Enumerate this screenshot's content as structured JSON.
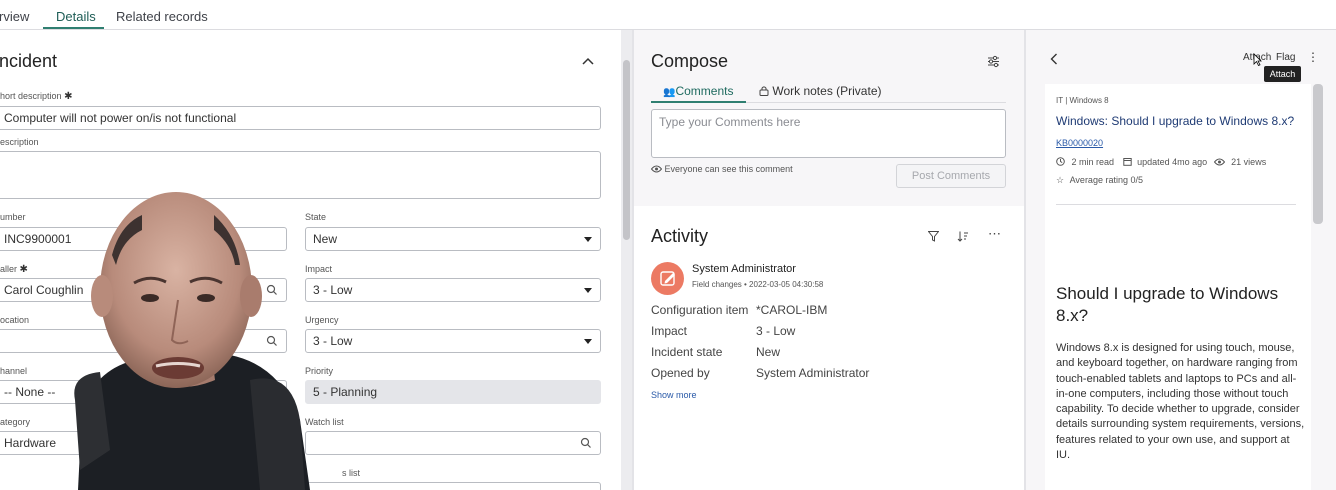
{
  "tabs": [
    {
      "label": "rview"
    },
    {
      "label": "Details"
    },
    {
      "label": "Related records"
    }
  ],
  "form": {
    "title": "ncident",
    "short_description_label": "hort description",
    "short_description_value": "Computer will not power on/is not functional",
    "description_label": "escription",
    "number_label": "umber",
    "number_value": "INC9900001",
    "state_label": "State",
    "state_value": "New",
    "caller_label": "aller",
    "caller_value": "Carol Coughlin",
    "impact_label": "Impact",
    "impact_value": "3 - Low",
    "location_label": "ocation",
    "urgency_label": "Urgency",
    "urgency_value": "3 - Low",
    "channel_label": "hannel",
    "channel_value": "-- None --",
    "priority_label": "Priority",
    "priority_value": "5 - Planning",
    "category_label": "ategory",
    "category_value": "Hardware",
    "watch_list_label": "Watch list",
    "work_notes_list_label": "s list"
  },
  "compose": {
    "title": "Compose",
    "tab_comments": "Comments",
    "tab_work_notes": "Work notes (Private)",
    "placeholder": "Type your Comments here",
    "visibility_note": "Everyone can see this comment",
    "post_button": "Post Comments"
  },
  "activity": {
    "title": "Activity",
    "author": "System Administrator",
    "meta": "Field changes • 2022-03-05 04:30:58",
    "rows": [
      {
        "key": "Configuration item",
        "value": "*CAROL-IBM"
      },
      {
        "key": "Impact",
        "value": "3 - Low"
      },
      {
        "key": "Incident state",
        "value": "New"
      },
      {
        "key": "Opened by",
        "value": "System Administrator"
      }
    ],
    "show_more": "Show more"
  },
  "kb": {
    "attach_label": "Attach",
    "flag_label": "Flag",
    "tooltip": "Attach",
    "category": "IT | Windows 8",
    "title": "Windows: Should I upgrade to Windows 8.x?",
    "number": "KB0000020",
    "read_time": "2 min read",
    "updated": "updated 4mo ago",
    "views": "21 views",
    "rating": "Average rating 0/5",
    "heading": "Should I upgrade to Windows 8.x?",
    "body": "Windows 8.x is designed for using touch, mouse, and keyboard together, on hardware ranging from touch-enabled tablets and laptops to PCs and all-in-one computers, including those without touch capability.  To decide whether to upgrade, consider details surrounding system requirements, versions, features related to your own use, and support at IU."
  },
  "colors": {
    "accent": "#2f7f71",
    "avatar": "#ec7a63",
    "link": "#2a5aa8"
  }
}
